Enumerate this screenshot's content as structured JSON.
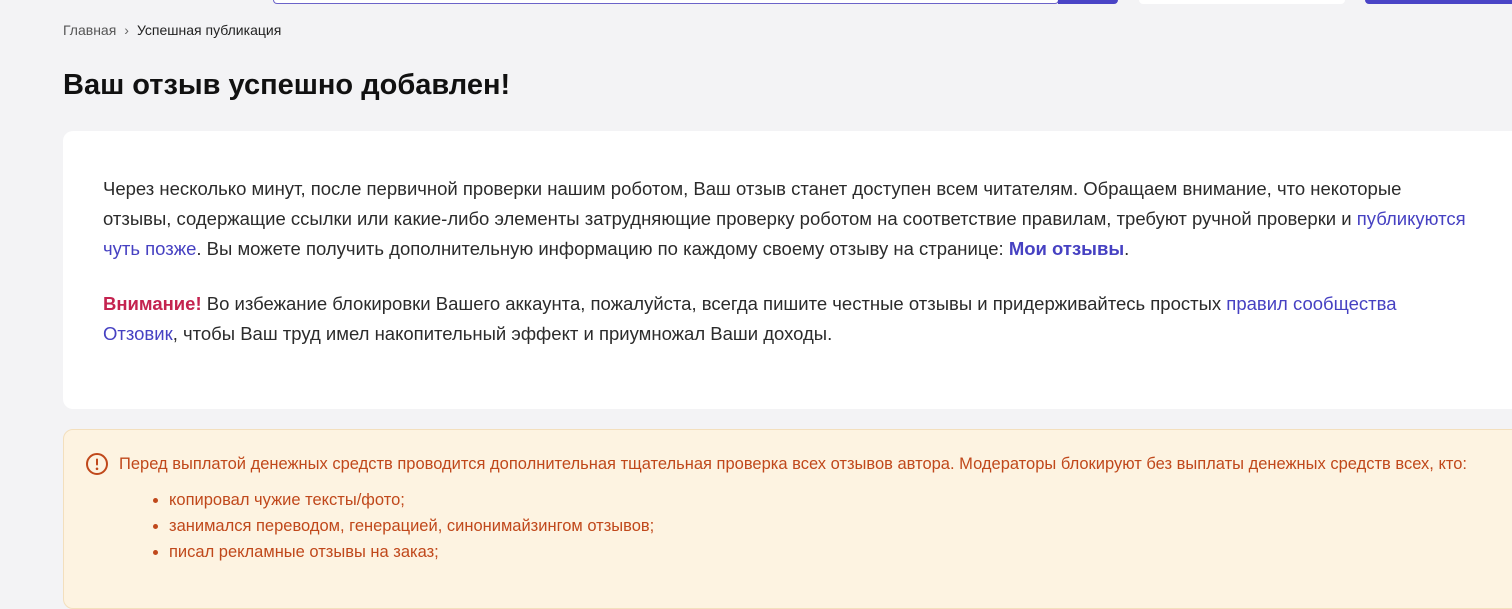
{
  "breadcrumb": {
    "home": "Главная",
    "separator": "›",
    "current": "Успешная публикация"
  },
  "page_title": "Ваш отзыв успешно добавлен!",
  "info": {
    "p1_text1": "Через несколько минут, после первичной проверки нашим роботом, Ваш отзыв станет доступен всем читателям. Обращаем внимание, что некоторые отзывы, содержащие ссылки или какие-либо элементы затрудняющие проверку роботом на соответствие правилам, требуют ручной проверки и ",
    "p1_link1": "публикуются чуть позже",
    "p1_text2": ". Вы можете получить дополнительную информацию по каждому своему отзыву на странице: ",
    "p1_link2": "Мои отзывы",
    "p1_text3": ".",
    "warn_label": "Внимание!",
    "p2_text1": " Во избежание блокировки Вашего аккаунта, пожалуйста, всегда пишите честные отзывы и придерживайтесь простых ",
    "p2_link": "правил сообщества Отзовик",
    "p2_text2": ", чтобы Ваш труд имел накопительный эффект и приумножал Ваши доходы."
  },
  "notice": {
    "icon": "exclamation-circle-icon",
    "text": "Перед выплатой денежных средств проводится дополнительная тщательная проверка всех отзывов автора. Модераторы блокируют без выплаты денежных средств всех, кто:",
    "items": [
      "копировал чужие тексты/фото;",
      "занимался переводом, генерацией, синонимайзингом отзывов;",
      "писал рекламные отзывы на заказ;"
    ]
  },
  "colors": {
    "accent": "#4641c2",
    "warning": "#c4234f",
    "notice_text": "#c0481b",
    "notice_bg": "#fdf3e1"
  }
}
